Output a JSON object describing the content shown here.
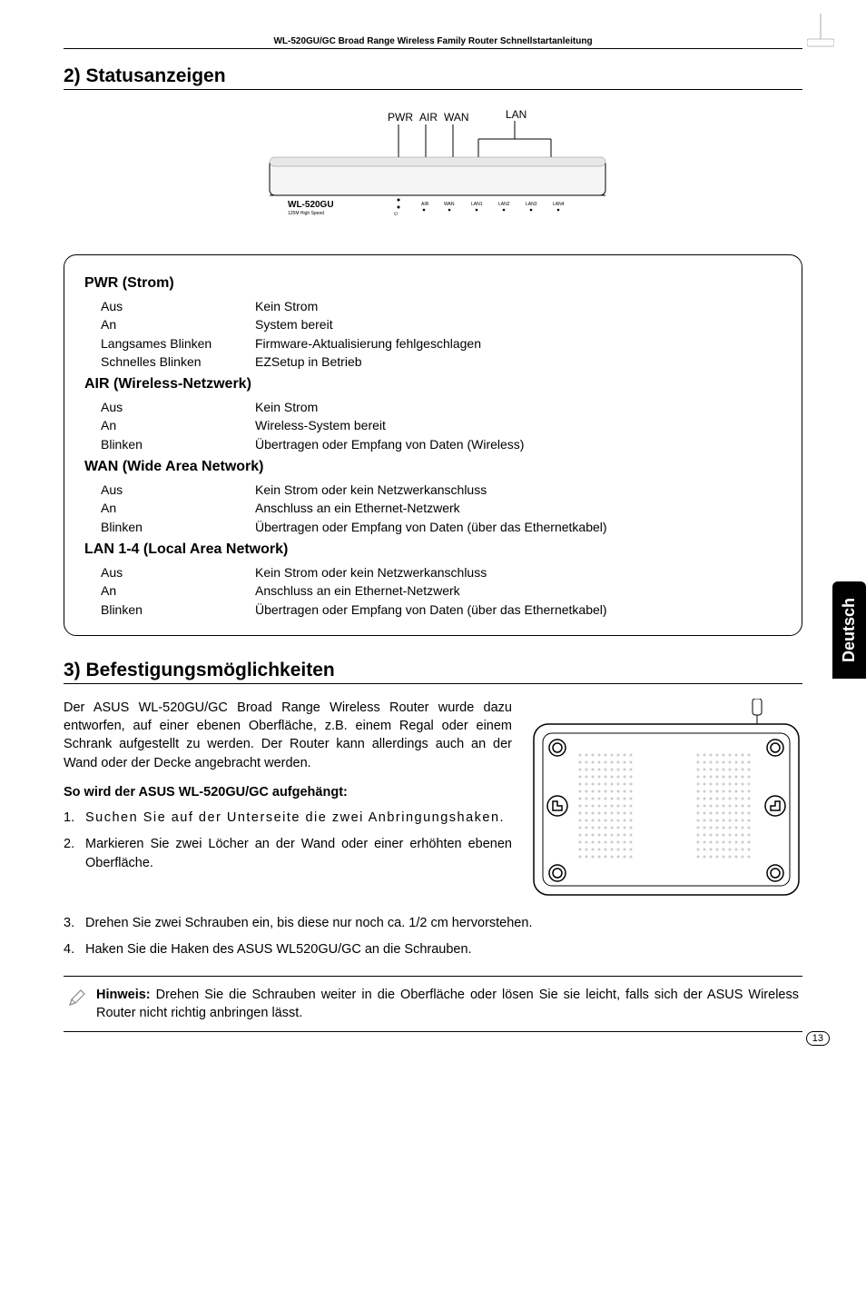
{
  "header": {
    "title": "WL-520GU/GC Broad Range Wireless Family Router Schnellstartanleitung"
  },
  "section2": {
    "title": "2) Statusanzeigen",
    "figure": {
      "model": "WL-520GU",
      "sub": "125M High Speed",
      "labels": {
        "pwr": "PWR",
        "air": "AIR",
        "wan": "WAN",
        "lan": "LAN"
      },
      "ports": [
        "AIR",
        "WAN",
        "LAN1",
        "LAN2",
        "LAN3",
        "LAN4"
      ]
    },
    "groups": [
      {
        "heading": "PWR (Strom)",
        "rows": [
          {
            "label": "Aus",
            "desc": "Kein Strom"
          },
          {
            "label": "An",
            "desc": "System bereit"
          },
          {
            "label": "Langsames Blinken",
            "desc": "Firmware-Aktualisierung fehlgeschlagen"
          },
          {
            "label": "Schnelles Blinken",
            "desc": "EZSetup in Betrieb"
          }
        ]
      },
      {
        "heading": "AIR (Wireless-Netzwerk)",
        "rows": [
          {
            "label": "Aus",
            "desc": "Kein Strom"
          },
          {
            "label": "An",
            "desc": "Wireless-System bereit"
          },
          {
            "label": "Blinken",
            "desc": "Übertragen oder Empfang von Daten (Wireless)"
          }
        ]
      },
      {
        "heading": "WAN (Wide Area Network)",
        "rows": [
          {
            "label": "Aus",
            "desc": "Kein Strom oder kein Netzwerkanschluss"
          },
          {
            "label": "An",
            "desc": "Anschluss an ein Ethernet-Netzwerk"
          },
          {
            "label": "Blinken",
            "desc": "Übertragen oder Empfang von Daten (über das Ethernetkabel)"
          }
        ]
      },
      {
        "heading": "LAN 1-4 (Local Area Network)",
        "rows": [
          {
            "label": "Aus",
            "desc": "Kein Strom oder kein Netzwerkanschluss"
          },
          {
            "label": "An",
            "desc": "Anschluss an ein Ethernet-Netzwerk"
          },
          {
            "label": "Blinken",
            "desc": "Übertragen oder Empfang von Daten (über das Ethernetkabel)"
          }
        ]
      }
    ]
  },
  "section3": {
    "title": "3) Befestigungsmöglichkeiten",
    "intro": "Der ASUS WL-520GU/GC Broad Range Wireless Router wurde dazu entworfen, auf einer ebenen Oberfläche, z.B. einem Regal oder einem Schrank aufgestellt zu werden. Der Router kann allerdings auch an der Wand oder der Decke angebracht werden.",
    "boldline": "So wird der ASUS WL-520GU/GC aufgehängt:",
    "steps": [
      "Suchen Sie auf der Unterseite die zwei Anbringungshaken.",
      "Markieren Sie zwei Löcher an der Wand oder einer erhöhten ebenen Oberfläche.",
      "Drehen Sie zwei Schrauben ein, bis diese nur noch ca. 1/2 cm hervorstehen.",
      "Haken Sie die Haken des ASUS WL520GU/GC an die Schrauben."
    ],
    "note_label": "Hinweis:",
    "note_text": " Drehen Sie die Schrauben weiter in die Oberfläche oder lösen Sie sie leicht, falls sich der ASUS Wireless Router nicht richtig anbringen lässt."
  },
  "sidetab": "Deutsch",
  "pagenum": "13"
}
